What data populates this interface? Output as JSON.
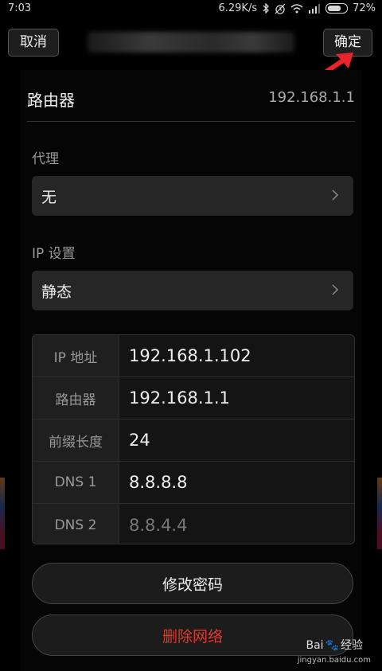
{
  "status": {
    "time": "7:03",
    "speed": "6.29K/s",
    "battery": "72%",
    "battery_level": 0.72
  },
  "header": {
    "cancel_label": "取消",
    "ok_label": "确定"
  },
  "router": {
    "label": "路由器",
    "value": "192.168.1.1"
  },
  "proxy": {
    "section_label": "代理",
    "value": "无"
  },
  "ip_settings": {
    "section_label": "IP 设置",
    "value": "静态"
  },
  "ip_table": {
    "rows": [
      {
        "key": "IP 地址",
        "value": "192.168.1.102"
      },
      {
        "key": "路由器",
        "value": "192.168.1.1"
      },
      {
        "key": "前缀长度",
        "value": "24"
      },
      {
        "key": "DNS 1",
        "value": "8.8.8.8"
      },
      {
        "key": "DNS 2",
        "value": "8.8.4.4"
      }
    ]
  },
  "actions": {
    "modify_password": "修改密码",
    "delete_network": "删除网络"
  },
  "watermark": {
    "brand": "Bai",
    "brand2": "经验",
    "url": "jingyan.baidu.com"
  },
  "colors": {
    "accent_red": "#e0392c",
    "background": "#000000"
  }
}
